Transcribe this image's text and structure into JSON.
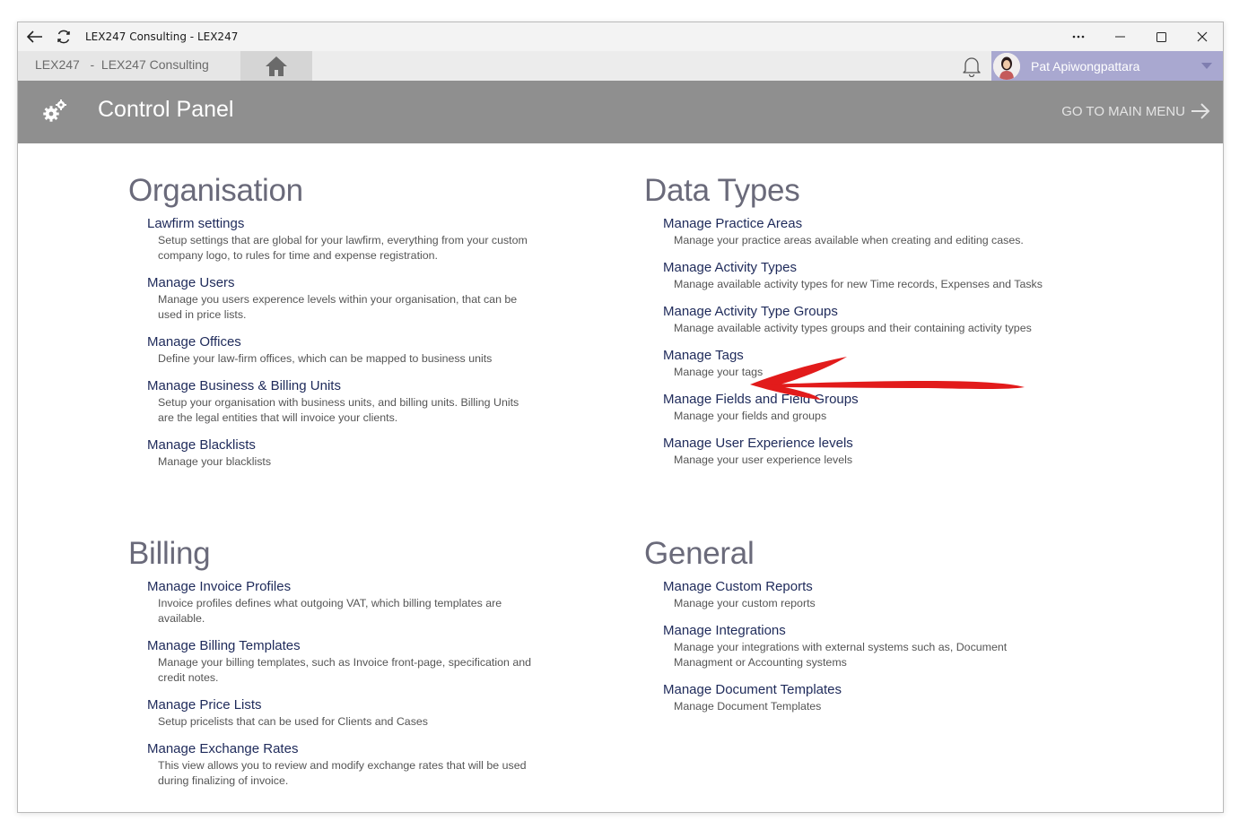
{
  "window": {
    "title": "LEX247 Consulting - LEX247"
  },
  "nav": {
    "tab_label": "LEX247   -  LEX247 Consulting",
    "user_name": "Pat Apiwongpattara"
  },
  "header": {
    "title": "Control Panel",
    "goto_main": "GO TO MAIN MENU"
  },
  "icons": {
    "back": "back-arrow-icon",
    "refresh": "refresh-icon",
    "more": "more-icon",
    "minimize": "minimize-icon",
    "maximize": "maximize-icon",
    "close": "close-icon",
    "home": "home-icon",
    "bell": "bell-icon",
    "settings": "gears-icon",
    "goto_arrow": "arrow-right-icon"
  },
  "colors": {
    "header_bg": "#8f8f8f",
    "user_bg": "#a9a8d0",
    "link": "#1e2a5a",
    "section_title": "#6a6a7a",
    "annotation_arrow": "#e21b1b"
  },
  "sections": {
    "organisation": {
      "title": "Organisation",
      "items": [
        {
          "title": "Lawfirm settings",
          "desc": "Setup settings that are global for your lawfirm, everything from your custom company logo, to rules for time and expense registration."
        },
        {
          "title": "Manage Users",
          "desc": "Manage you users experence levels within your organisation, that can be used in price lists."
        },
        {
          "title": "Manage Offices",
          "desc": "Define your law-firm offices, which can be mapped to business units"
        },
        {
          "title": "Manage Business & Billing Units",
          "desc": "Setup your organisation with business units, and billing units. Billing Units are the legal entities that will invoice your clients."
        },
        {
          "title": "Manage Blacklists",
          "desc": "Manage your blacklists"
        }
      ]
    },
    "data_types": {
      "title": "Data Types",
      "items": [
        {
          "title": "Manage Practice Areas",
          "desc": "Manage your practice areas available when creating and editing cases."
        },
        {
          "title": "Manage Activity Types",
          "desc": "Manage available activity types for new Time records, Expenses and Tasks"
        },
        {
          "title": "Manage Activity Type Groups",
          "desc": "Manage available activity types groups and their containing activity types"
        },
        {
          "title": "Manage Tags",
          "desc": "Manage your tags"
        },
        {
          "title": "Manage Fields and Field Groups",
          "desc": "Manage your fields and groups"
        },
        {
          "title": "Manage User Experience levels",
          "desc": "Manage your user experience levels"
        }
      ]
    },
    "billing": {
      "title": "Billing",
      "items": [
        {
          "title": "Manage Invoice Profiles",
          "desc": "Invoice profiles defines what outgoing VAT, which billing templates are available."
        },
        {
          "title": "Manage Billing Templates",
          "desc": "Manage your billing templates, such as Invoice front-page, specification and credit notes."
        },
        {
          "title": "Manage Price Lists",
          "desc": "Setup pricelists that can be used for Clients and Cases"
        },
        {
          "title": "Manage Exchange Rates",
          "desc": "This view allows you to review and modify exchange rates that will be used during finalizing of invoice."
        }
      ]
    },
    "general": {
      "title": "General",
      "items": [
        {
          "title": "Manage Custom Reports",
          "desc": "Manage your custom reports"
        },
        {
          "title": "Manage Integrations",
          "desc": "Manage your integrations with external systems such as, Document Managment or Accounting systems"
        },
        {
          "title": "Manage Document Templates",
          "desc": "Manage Document Templates"
        }
      ]
    }
  }
}
